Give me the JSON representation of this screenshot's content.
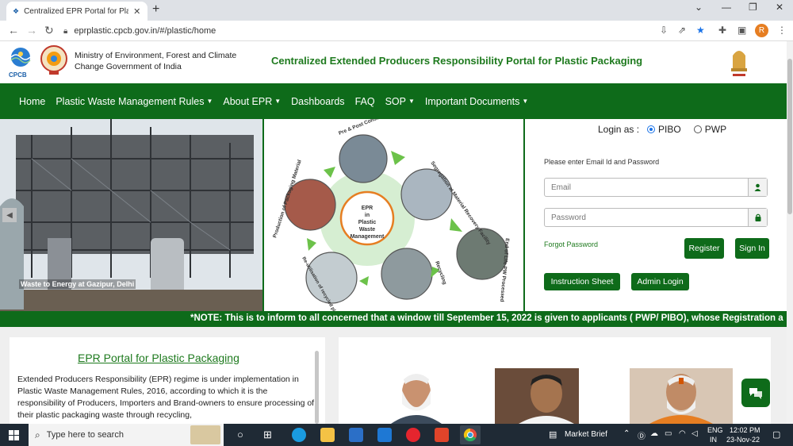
{
  "browser": {
    "tab_title": "Centralized EPR Portal for Plastic",
    "tab_close": "✕",
    "new_tab": "+",
    "url": "eprplastic.cpcb.gov.in/#/plastic/home",
    "profile_initial": "R"
  },
  "header": {
    "cpcb_label": "CPCB",
    "ministry": "Ministry of Environment, Forest and Climate Change Government of India",
    "portal_title": "Centralized Extended Producers Responsibility Portal for Plastic Packaging"
  },
  "nav": {
    "items": [
      {
        "label": "Home",
        "dropdown": false
      },
      {
        "label": "Plastic Waste Management Rules",
        "dropdown": true
      },
      {
        "label": "About EPR",
        "dropdown": true
      },
      {
        "label": "Dashboards",
        "dropdown": false
      },
      {
        "label": "FAQ",
        "dropdown": false
      },
      {
        "label": "SOP",
        "dropdown": true
      },
      {
        "label": "Important Documents",
        "dropdown": true
      }
    ]
  },
  "banner": {
    "photo_caption": "Waste to Energy at Gazipur, Delhi",
    "cycle_center": [
      "EPR",
      "in",
      "Plastic",
      "Waste",
      "Management"
    ],
    "cycle_labels": {
      "pre_post": "Pre & Post Consumer Plastic Waste",
      "segregation": "Segregation at Material Recovery Facility",
      "end_of_life": "End of Life PW Processed",
      "recycling": "Recycling",
      "reutilization": "Re-utilisation of recycled plastic",
      "production": "Production of Packaging Material"
    }
  },
  "login": {
    "login_as": "Login as :",
    "option_pibo": "PIBO",
    "option_pwp": "PWP",
    "selected": "PIBO",
    "prompt": "Please enter Email Id and Password",
    "email_placeholder": "Email",
    "password_placeholder": "Password",
    "forgot": "Forgot Password",
    "register": "Register",
    "sign_in": "Sign In",
    "instruction_sheet": "Instruction Sheet",
    "admin_login": "Admin Login"
  },
  "ticker": {
    "text": "*NOTE: This is to inform to all concerned that a window till September 15, 2022 is given to applicants ( PWP/ PIBO), whose Registration a"
  },
  "epr": {
    "title": "EPR Portal for Plastic Packaging",
    "text": "Extended Producers Responsibility (EPR) regime is under implementation in Plastic Waste Management Rules, 2016, according to which it is the responsibility of Producers, Importers and Brand-owners to ensure processing of their plastic packaging waste through recycling,"
  },
  "taskbar": {
    "search_placeholder": "Type here to search",
    "market": "Market Brief",
    "lang1": "ENG",
    "lang2": "IN",
    "time": "12:02 PM",
    "date": "23-Nov-22"
  },
  "colors": {
    "primary_green": "#0e6b1a",
    "title_green": "#1e7a1e"
  }
}
